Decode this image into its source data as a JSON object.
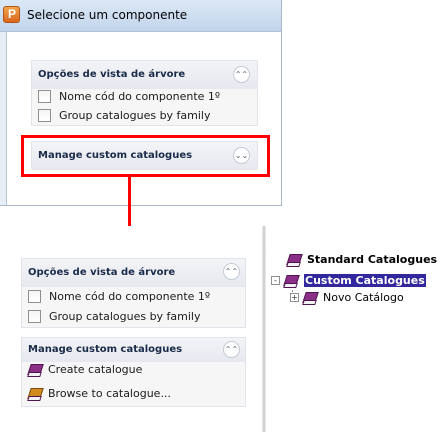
{
  "window": {
    "title": "Selecione um componente"
  },
  "top_panel": {
    "tree_options": {
      "title": "Opções de vista de árvore",
      "options": [
        {
          "label": "Nome cód do componente 1º",
          "checked": false
        },
        {
          "label": "Group catalogues by family",
          "checked": false
        }
      ]
    },
    "manage": {
      "title": "Manage custom catalogues",
      "state": "collapsed"
    }
  },
  "bottom_panel": {
    "tree_options": {
      "title": "Opções de vista de árvore",
      "options": [
        {
          "label": "Nome cód do componente 1º",
          "checked": false
        },
        {
          "label": "Group catalogues by family",
          "checked": false
        }
      ]
    },
    "manage": {
      "title": "Manage custom catalogues",
      "state": "expanded",
      "links": [
        {
          "label": "Create catalogue",
          "icon": "catalogue-book-icon"
        },
        {
          "label": "Browse to catalogue...",
          "icon": "browse-book-icon"
        }
      ]
    }
  },
  "tree": {
    "nodes": [
      {
        "label": "Standard Catalogues",
        "bold": true,
        "selected": false,
        "icon": "catalogue-book-icon"
      },
      {
        "label": "Custom Catalogues",
        "bold": true,
        "selected": true,
        "expander": "-",
        "icon": "catalogue-book-icon"
      },
      {
        "label": "Novo Catálogo",
        "bold": false,
        "selected": false,
        "expander": "+",
        "icon": "catalogue-book-icon"
      }
    ]
  },
  "colors": {
    "highlight": "#ff0000",
    "selection": "#30289c",
    "pane_title": "#1a2b4a"
  }
}
